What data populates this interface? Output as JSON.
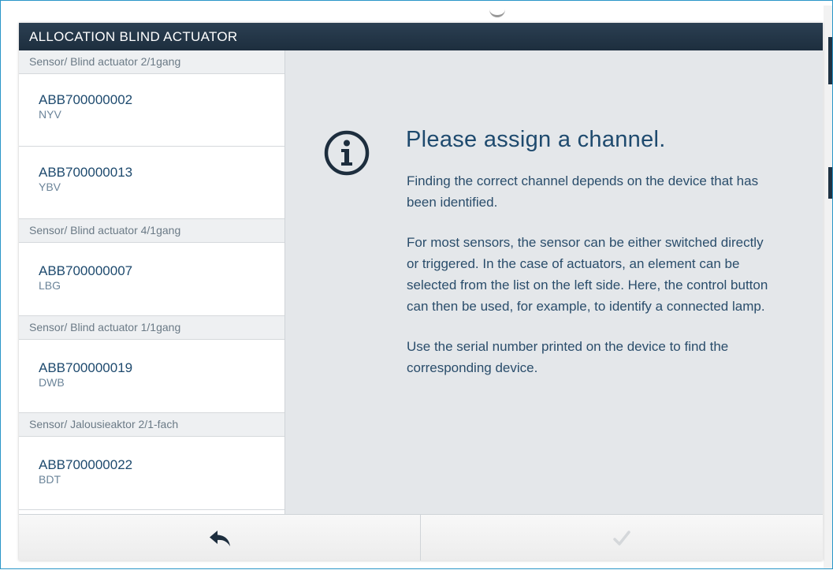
{
  "dialog": {
    "title": "ALLOCATION BLIND ACTUATOR"
  },
  "sidebar": {
    "groups": [
      {
        "header": "Sensor/ Blind actuator 2/1gang",
        "devices": [
          {
            "id": "ABB700000002",
            "code": "NYV"
          },
          {
            "id": "ABB700000013",
            "code": "YBV"
          }
        ]
      },
      {
        "header": "Sensor/ Blind actuator 4/1gang",
        "devices": [
          {
            "id": "ABB700000007",
            "code": "LBG"
          }
        ]
      },
      {
        "header": "Sensor/ Blind actuator 1/1gang",
        "devices": [
          {
            "id": "ABB700000019",
            "code": "DWB"
          }
        ]
      },
      {
        "header": "Sensor/ Jalousieaktor 2/1-fach",
        "devices": [
          {
            "id": "ABB700000022",
            "code": "BDT"
          }
        ]
      }
    ]
  },
  "content": {
    "icon": "info-icon",
    "heading": "Please assign a channel.",
    "paragraphs": [
      "Finding the correct channel depends on the device that has been identified.",
      "For most sensors, the sensor can be either switched directly or triggered. In the case of actuators, an element can be selected from the list on the left side. Here, the control button can then be used, for example, to identify a connected lamp.",
      "Use the serial number printed on the device to find the corresponding device."
    ]
  },
  "footer": {
    "back_icon": "back-arrow-icon",
    "confirm_icon": "checkmark-icon"
  },
  "colors": {
    "titlebar": "#1d2e3e",
    "text_primary": "#1e4a6e",
    "content_bg": "#e4e7ea",
    "frame_border": "#2a96c8"
  }
}
